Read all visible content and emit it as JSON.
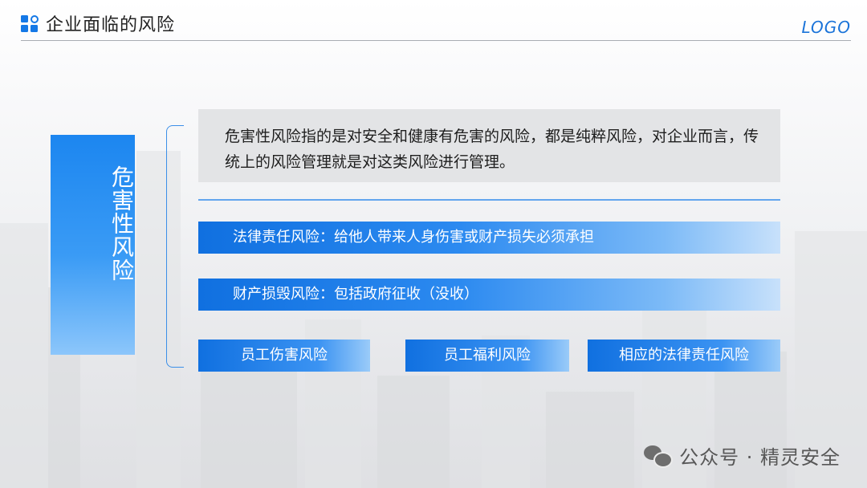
{
  "header": {
    "title": "企业面临的风险",
    "logo": "LOGO"
  },
  "side_label": {
    "chars": [
      "危",
      "害",
      "性",
      "风",
      "险"
    ]
  },
  "definition": {
    "text": "危害性风险指的是对安全和健康有危害的风险，都是纯粹风险，对企业而言，传统上的风险管理就是对这类风险进行管理。"
  },
  "items": {
    "legal": "法律责任风险：给他人带来人身伤害或财产损失必须承担",
    "property": "财产损毁风险：包括政府征收（没收）",
    "employee_injury": "员工伤害风险",
    "employee_welfare": "员工福利风险",
    "legal_liability": "相应的法律责任风险"
  },
  "watermark": {
    "text": "公众号 · 精灵安全",
    "icon": "wechat-icon"
  },
  "colors": {
    "accent": "#1478e6",
    "bar_start": "#1070e0",
    "bar_end": "#c8e1fb",
    "definition_bg": "#e3e4e6"
  }
}
